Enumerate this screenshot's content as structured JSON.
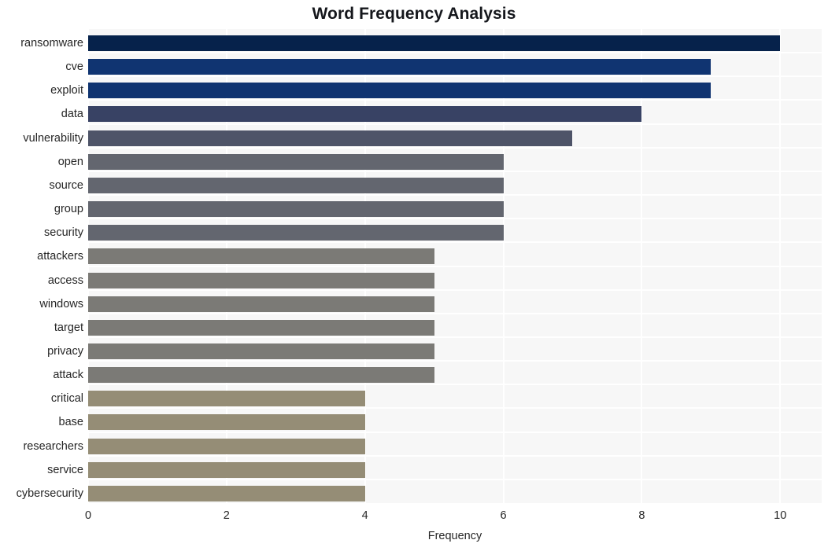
{
  "chart_data": {
    "type": "bar",
    "orientation": "horizontal",
    "title": "Word Frequency Analysis",
    "xlabel": "Frequency",
    "ylabel": "",
    "xlim": [
      0,
      10.6
    ],
    "ylim": [
      0,
      20
    ],
    "grid": true,
    "legend": null,
    "xticks": [
      "0",
      "2",
      "4",
      "6",
      "8",
      "10"
    ],
    "xtick_values": [
      0,
      2,
      4,
      6,
      8,
      10
    ],
    "categories": [
      "ransomware",
      "cve",
      "exploit",
      "data",
      "vulnerability",
      "open",
      "source",
      "group",
      "security",
      "attackers",
      "access",
      "windows",
      "target",
      "privacy",
      "attack",
      "critical",
      "base",
      "researchers",
      "service",
      "cybersecurity"
    ],
    "values": [
      10,
      9,
      9,
      8,
      7,
      6,
      6,
      6,
      6,
      5,
      5,
      5,
      5,
      5,
      5,
      4,
      4,
      4,
      4,
      4
    ],
    "bar_colors": [
      "#06224b",
      "#103471",
      "#103471",
      "#384264",
      "#4e5468",
      "#63666f",
      "#63666f",
      "#63666f",
      "#63666f",
      "#7b7a76",
      "#7b7a76",
      "#7b7a76",
      "#7b7a76",
      "#7b7a76",
      "#7b7a76",
      "#958d76",
      "#958d76",
      "#958d76",
      "#958d76",
      "#958d76"
    ],
    "bars": [
      {
        "label": "ransomware",
        "value": 10,
        "color": "#06224b"
      },
      {
        "label": "cve",
        "value": 9,
        "color": "#103471"
      },
      {
        "label": "exploit",
        "value": 9,
        "color": "#103471"
      },
      {
        "label": "data",
        "value": 8,
        "color": "#384264"
      },
      {
        "label": "vulnerability",
        "value": 7,
        "color": "#4e5468"
      },
      {
        "label": "open",
        "value": 6,
        "color": "#63666f"
      },
      {
        "label": "source",
        "value": 6,
        "color": "#63666f"
      },
      {
        "label": "group",
        "value": 6,
        "color": "#63666f"
      },
      {
        "label": "security",
        "value": 6,
        "color": "#63666f"
      },
      {
        "label": "attackers",
        "value": 5,
        "color": "#7b7a76"
      },
      {
        "label": "access",
        "value": 5,
        "color": "#7b7a76"
      },
      {
        "label": "windows",
        "value": 5,
        "color": "#7b7a76"
      },
      {
        "label": "target",
        "value": 5,
        "color": "#7b7a76"
      },
      {
        "label": "privacy",
        "value": 5,
        "color": "#7b7a76"
      },
      {
        "label": "attack",
        "value": 5,
        "color": "#7b7a76"
      },
      {
        "label": "critical",
        "value": 4,
        "color": "#958d76"
      },
      {
        "label": "base",
        "value": 4,
        "color": "#958d76"
      },
      {
        "label": "researchers",
        "value": 4,
        "color": "#958d76"
      },
      {
        "label": "service",
        "value": 4,
        "color": "#958d76"
      },
      {
        "label": "cybersecurity",
        "value": 4,
        "color": "#958d76"
      }
    ],
    "style": {
      "plot_background": "#f7f7f7",
      "figure_background": "#ffffff",
      "gridline_color": "#ffffff",
      "tick_label_color": "#262626",
      "title_color": "#15171c"
    }
  }
}
